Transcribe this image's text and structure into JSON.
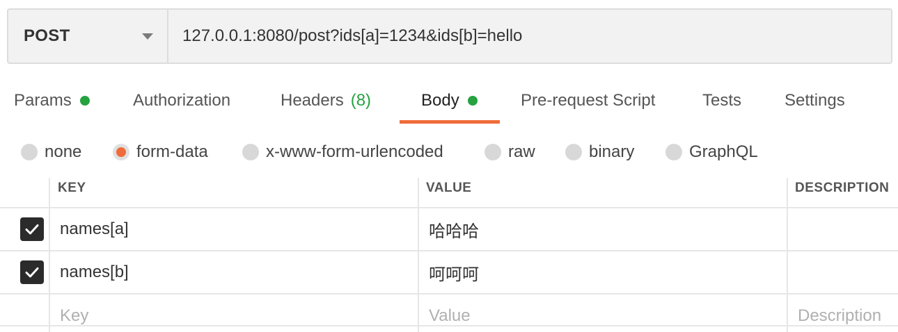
{
  "request": {
    "method": "POST",
    "url": "127.0.0.1:8080/post?ids[a]=1234&ids[b]=hello"
  },
  "tabs": [
    {
      "label": "Params",
      "dot": true
    },
    {
      "label": "Authorization"
    },
    {
      "label": "Headers",
      "count": "(8)"
    },
    {
      "label": "Body",
      "dot": true,
      "active": true
    },
    {
      "label": "Pre-request Script"
    },
    {
      "label": "Tests"
    },
    {
      "label": "Settings"
    }
  ],
  "body_types": [
    {
      "label": "none"
    },
    {
      "label": "form-data",
      "selected": true
    },
    {
      "label": "x-www-form-urlencoded"
    },
    {
      "label": "raw"
    },
    {
      "label": "binary"
    },
    {
      "label": "GraphQL"
    }
  ],
  "table": {
    "headers": {
      "key": "KEY",
      "value": "VALUE",
      "description": "DESCRIPTION"
    },
    "rows": [
      {
        "checked": true,
        "key": "names[a]",
        "value": "哈哈哈",
        "description": ""
      },
      {
        "checked": true,
        "key": "names[b]",
        "value": "呵呵呵",
        "description": ""
      }
    ],
    "new_row": {
      "key_placeholder": "Key",
      "value_placeholder": "Value",
      "description_placeholder": "Description"
    }
  },
  "colors": {
    "accent": "#ef6c3a",
    "status_green": "#26a240",
    "checkbox": "#2b2b2b"
  },
  "icons": {
    "method_dropdown": "chevron-down-icon",
    "checkbox": "checkmark-icon"
  }
}
